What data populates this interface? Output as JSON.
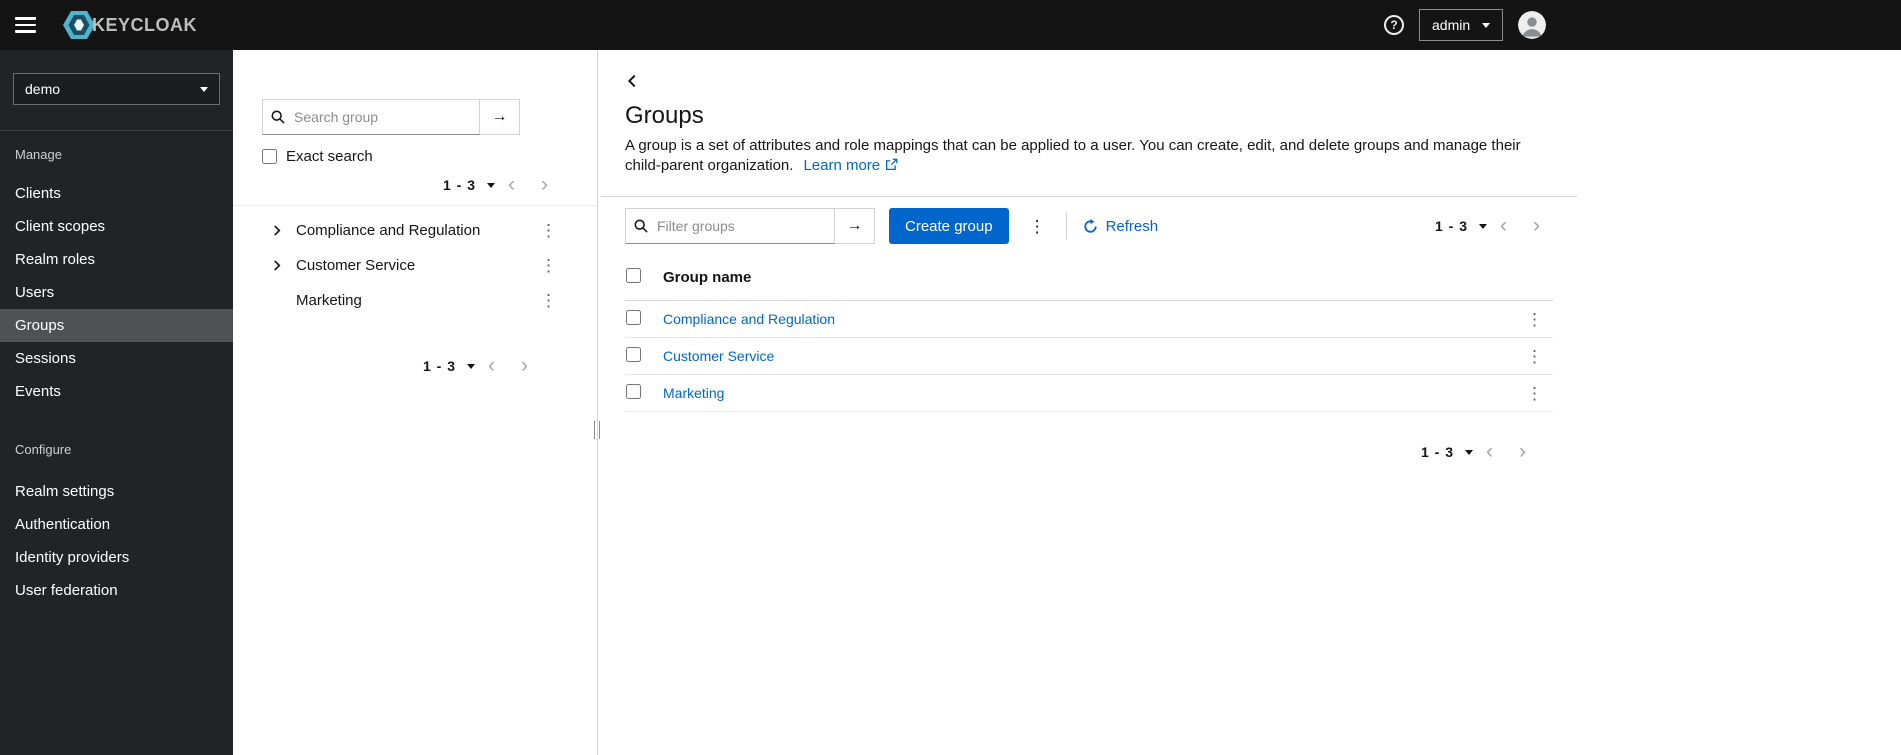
{
  "header": {
    "brand_text": "KEYCLOAK",
    "user": "admin"
  },
  "sidebar": {
    "realm": "demo",
    "sections": [
      {
        "title": "Manage",
        "items": [
          {
            "label": "Clients"
          },
          {
            "label": "Client scopes"
          },
          {
            "label": "Realm roles"
          },
          {
            "label": "Users"
          },
          {
            "label": "Groups",
            "selected": true
          },
          {
            "label": "Sessions"
          },
          {
            "label": "Events"
          }
        ]
      },
      {
        "title": "Configure",
        "items": [
          {
            "label": "Realm settings"
          },
          {
            "label": "Authentication"
          },
          {
            "label": "Identity providers"
          },
          {
            "label": "User federation"
          }
        ]
      }
    ]
  },
  "tree_panel": {
    "search_placeholder": "Search group",
    "exact_search_label": "Exact search",
    "pagination_top": "1 - 3",
    "pagination_bottom": "1 - 3",
    "items": [
      {
        "label": "Compliance and Regulation",
        "expandable": true
      },
      {
        "label": "Customer Service",
        "expandable": true
      },
      {
        "label": "Marketing",
        "expandable": false
      }
    ]
  },
  "main": {
    "title": "Groups",
    "description": "A group is a set of attributes and role mappings that can be applied to a user. You can create, edit, and delete groups and manage their child-parent organization.",
    "learn_more_label": "Learn more",
    "toolbar": {
      "filter_placeholder": "Filter groups",
      "create_button_label": "Create group",
      "refresh_label": "Refresh",
      "pagination": "1 - 3"
    },
    "table": {
      "columns": [
        "Group name"
      ],
      "rows": [
        {
          "name": "Compliance and Regulation"
        },
        {
          "name": "Customer Service"
        },
        {
          "name": "Marketing"
        }
      ]
    },
    "pagination_bottom": "1 - 3"
  },
  "icons": {
    "kebab": "⋮",
    "arrow_right": "→",
    "prev": "‹",
    "next": "›",
    "help": "?"
  },
  "colors": {
    "accent": "#0066cc",
    "link": "#0066cc",
    "header_bg": "#141414",
    "sidebar_bg": "#212427",
    "sidebar_selected_bg": "#4f5255",
    "border": "#d2d2d2"
  }
}
